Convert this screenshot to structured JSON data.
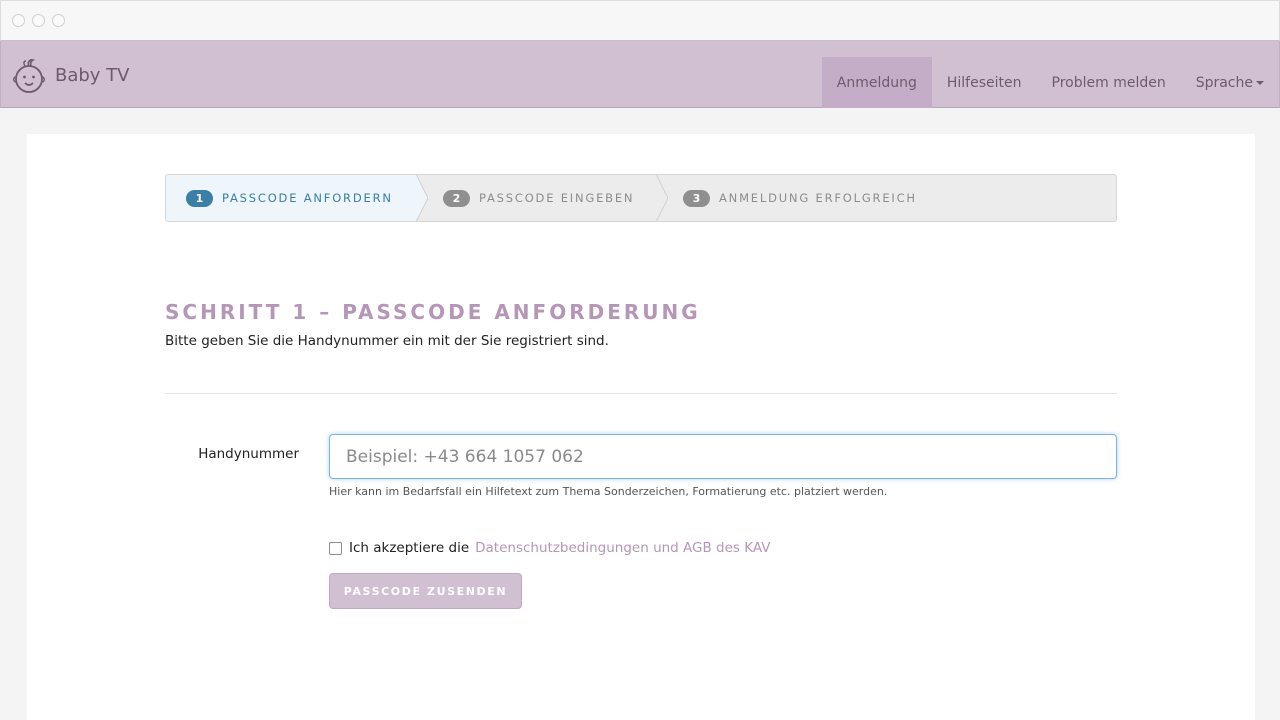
{
  "window": {
    "controls": [
      "close",
      "minimize",
      "maximize"
    ]
  },
  "navbar": {
    "brand": {
      "name": "Baby TV",
      "icon": "baby-face-icon"
    },
    "items": [
      {
        "label": "Anmeldung",
        "active": true
      },
      {
        "label": "Hilfeseiten",
        "active": false
      },
      {
        "label": "Problem melden",
        "active": false
      },
      {
        "label": "Sprache",
        "active": false,
        "dropdown": true
      }
    ]
  },
  "wizard": {
    "steps": [
      {
        "number": "1",
        "label": "PASSCODE ANFORDERN",
        "active": true
      },
      {
        "number": "2",
        "label": "PASSCODE EINGEBEN",
        "active": false
      },
      {
        "number": "3",
        "label": "ANMELDUNG ERFOLGREICH",
        "active": false
      }
    ]
  },
  "main": {
    "heading": "SCHRITT 1 – PASSCODE ANFORDERUNG",
    "subtext": "Bitte geben Sie die Handynummer ein mit der Sie registriert sind."
  },
  "form": {
    "phone_label": "Handynummer",
    "phone_value": "",
    "phone_placeholder": "Beispiel: +43 664 1057 062",
    "help_text": "Hier kann im Bedarfsfall ein Hilfetext zum Thema Sonderzeichen, Formatierung etc. platziert werden.",
    "terms_prefix": "Ich akzeptiere die",
    "terms_link": "Datenschutzbedingungen und AGB des KAV",
    "terms_checked": false,
    "submit_label": "PASSCODE ZUSENDEN"
  },
  "colors": {
    "navbar_bg": "#d1bfd2",
    "nav_active_bg": "#c4adc6",
    "accent_purple": "#b596b7",
    "step_active_blue": "#3b7ea6",
    "input_focus": "#7fb3e0"
  }
}
